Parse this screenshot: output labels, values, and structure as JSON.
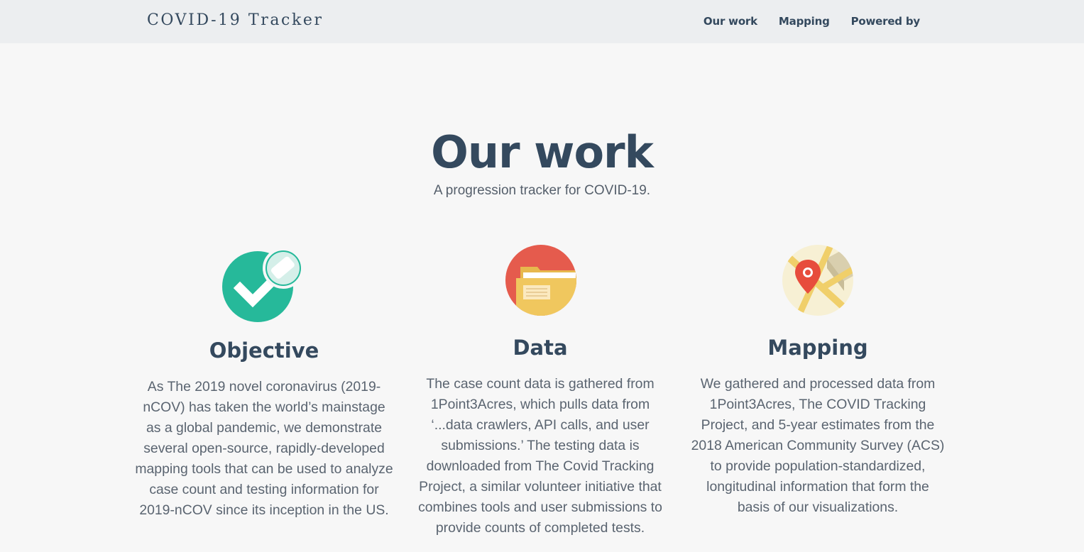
{
  "navbar": {
    "brand": "COVID-19 Tracker",
    "links": [
      {
        "label": "Our work"
      },
      {
        "label": "Mapping"
      },
      {
        "label": "Powered by"
      }
    ]
  },
  "hero": {
    "title": "Our work",
    "subtitle": "A progression tracker for COVID-19."
  },
  "features": [
    {
      "icon": "checkmark-icon",
      "title": "Objective",
      "text": "As The 2019 novel coronavirus (2019-nCOV) has taken the world’s mainstage as a global pandemic, we demonstrate several open-source, rapidly-developed mapping tools that can be used to analyze case count and testing information for 2019-nCOV since its inception in the US."
    },
    {
      "icon": "folder-icon",
      "title": "Data",
      "text": "The case count data is gathered from 1Point3Acres, which pulls data from ‘...data crawlers, API calls, and user submissions.’ The testing data is downloaded from The Covid Tracking Project, a similar volunteer initiative that combines tools and user submissions to provide counts of completed tests."
    },
    {
      "icon": "map-pin-icon",
      "title": "Mapping",
      "text": "We gathered and processed data from 1Point3Acres, The COVID Tracking Project, and 5-year estimates from the 2018 American Community Survey (ACS) to provide population-standardized, longitudinal information that form the basis of our visualizations."
    }
  ],
  "colors": {
    "navbar_bg": "#eceef0",
    "page_bg": "#f7f7f7",
    "heading": "#34495e",
    "check_green": "#26b99a",
    "folder_red": "#e55b4d",
    "folder_yellow": "#f0c75e",
    "map_bg": "#f7f0d4",
    "pin_red": "#e74c3c"
  }
}
